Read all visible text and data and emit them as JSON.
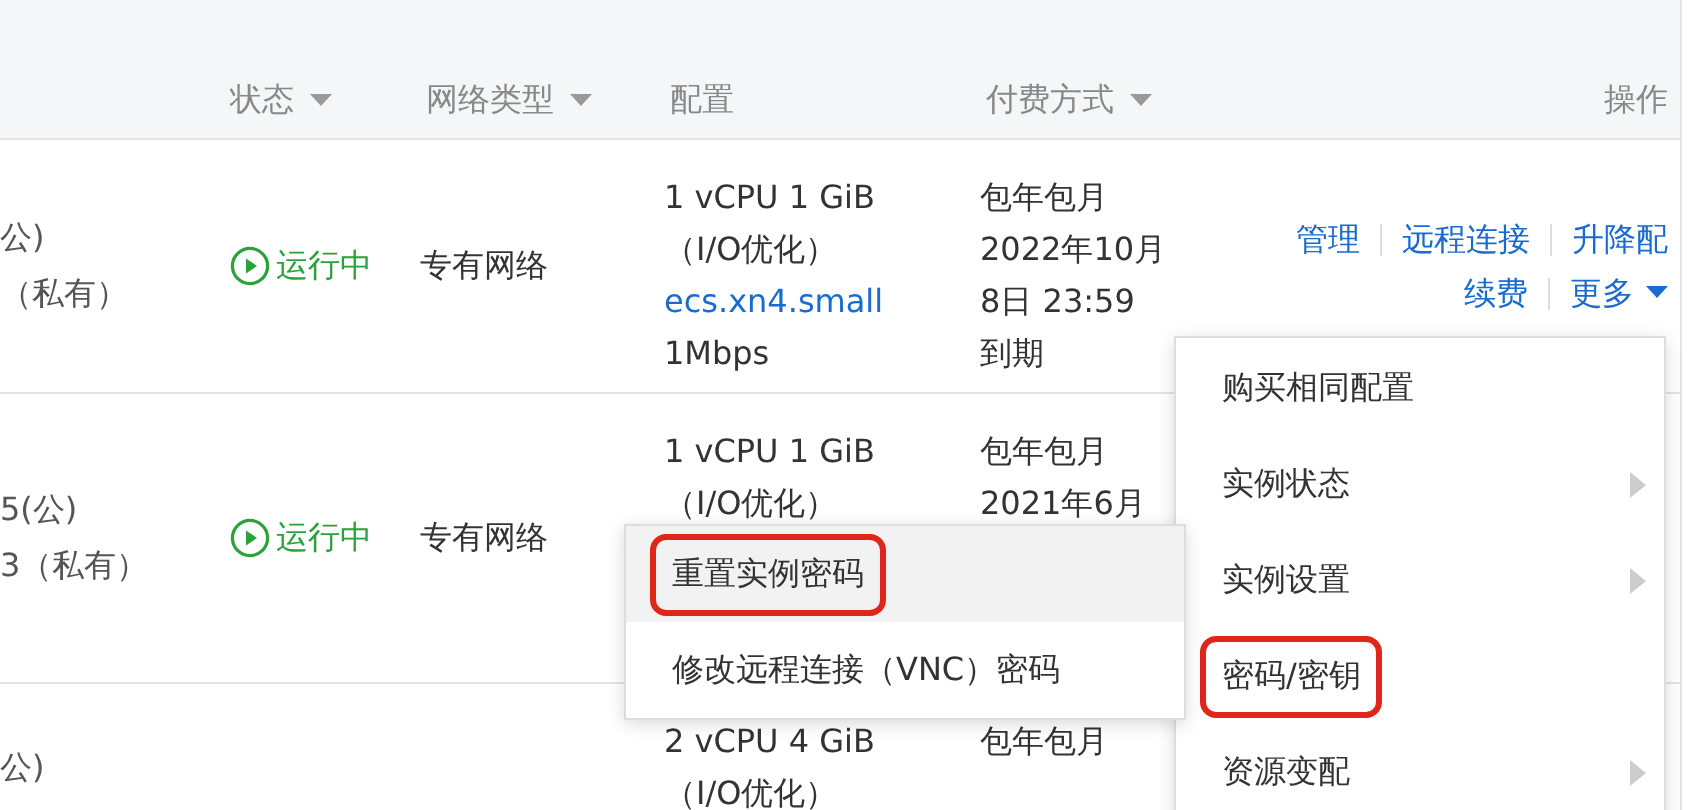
{
  "table": {
    "columns": [
      {
        "label": "状态",
        "filter": true
      },
      {
        "label": "网络类型",
        "filter": true
      },
      {
        "label": "配置",
        "filter": false
      },
      {
        "label": "付费方式",
        "filter": true
      },
      {
        "label": "操作",
        "filter": false
      }
    ],
    "rows": [
      {
        "address_lines": [
          "公)",
          "（私有）"
        ],
        "status": {
          "kind": "running",
          "label": "运行中"
        },
        "network": "专有网络",
        "config_lines": [
          {
            "text": "1 vCPU 1 GiB",
            "link": false
          },
          {
            "text": "（I/O优化）",
            "link": false
          },
          {
            "text": "ecs.xn4.small",
            "link": true
          },
          {
            "text": "1Mbps",
            "link": false
          }
        ],
        "billing_lines": [
          "包年包月",
          "2022年10月",
          "8日 23:59",
          "到期"
        ],
        "actions": [
          [
            {
              "label": "管理",
              "dropdown": false
            },
            {
              "label": "远程连接",
              "dropdown": false
            },
            {
              "label": "升降配",
              "dropdown": false
            }
          ],
          [
            {
              "label": "续费",
              "dropdown": false
            },
            {
              "label": "更多",
              "dropdown": true
            }
          ]
        ]
      },
      {
        "address_lines": [
          "5(公)",
          "3（私有）"
        ],
        "status": {
          "kind": "running",
          "label": "运行中"
        },
        "network": "专有网络",
        "config_lines": [
          {
            "text": "1 vCPU 1 GiB",
            "link": false
          },
          {
            "text": "（I/O优化）",
            "link": false
          }
        ],
        "billing_lines": [
          "包年包月",
          "2021年6月"
        ],
        "actions": []
      },
      {
        "address_lines": [
          "公)"
        ],
        "config_lines": [
          {
            "text": "2 vCPU 4 GiB",
            "link": false
          },
          {
            "text": "（I/O优化）",
            "link": false
          }
        ],
        "billing_lines": [
          "包年包月"
        ],
        "actions": []
      }
    ]
  },
  "more_menu": {
    "items": [
      {
        "label": "购买相同配置",
        "submenu": false,
        "marked": false
      },
      {
        "label": "实例状态",
        "submenu": true,
        "marked": false
      },
      {
        "label": "实例设置",
        "submenu": true,
        "marked": false
      },
      {
        "label": "密码/密钥",
        "submenu": false,
        "marked": true
      },
      {
        "label": "资源变配",
        "submenu": true,
        "marked": false
      }
    ]
  },
  "submenu": {
    "items": [
      {
        "label": "重置实例密码",
        "hovered": true,
        "marked": true
      },
      {
        "label": "修改远程连接（VNC）密码",
        "hovered": false,
        "marked": false
      }
    ]
  }
}
